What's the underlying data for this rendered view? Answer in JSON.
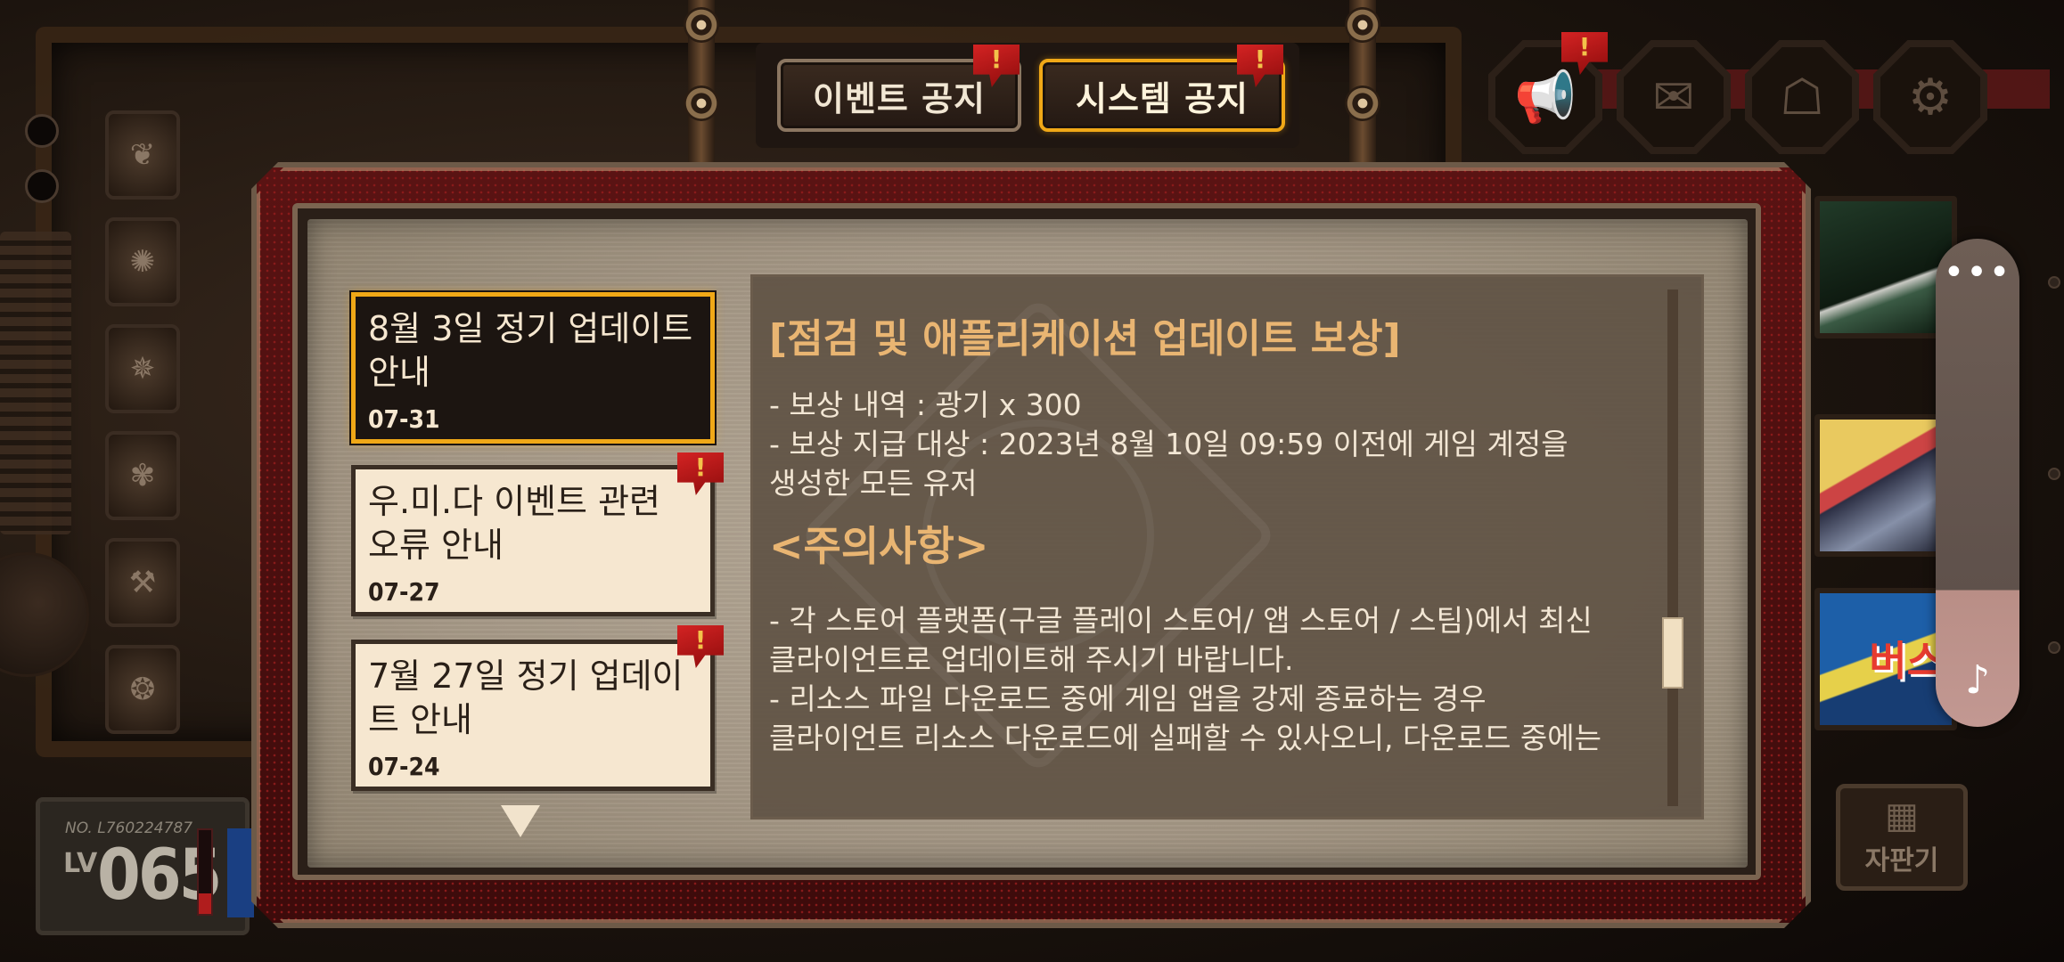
{
  "tabs": [
    {
      "label": "이벤트 공지",
      "active": false,
      "alert": "!"
    },
    {
      "label": "시스템 공지",
      "active": true,
      "alert": "!"
    }
  ],
  "notices": [
    {
      "title": "8월 3일 정기 업데이트 안내",
      "date": "07-31",
      "selected": true,
      "alert": ""
    },
    {
      "title": "우.미.다 이벤트 관련 오류 안내",
      "date": "07-27",
      "selected": false,
      "alert": "!"
    },
    {
      "title": "7월 27일 정기 업데이트 안내",
      "date": "07-24",
      "selected": false,
      "alert": "!"
    }
  ],
  "content": {
    "heading": "[점검 및 애플리케이션 업데이트 보상]",
    "lines1": [
      "- 보상 내역 : 광기 x 300",
      "- 보상 지급 대상 : 2023년 8월 10일 09:59 이전에 게임 계정을",
      "생성한 모든 유저"
    ],
    "subheading": "<주의사항>",
    "lines2": [
      "- 각 스토어 플랫폼(구글 플레이 스토어/ 앱 스토어 / 스팀)에서 최신",
      "클라이언트로 업데이트해 주시기 바랍니다.",
      "- 리소스 파일 다운로드 중에 게임 앱을 강제 종료하는 경우",
      "클라이언트 리소스 다운로드에 실패할 수 있사오니, 다운로드 중에는"
    ]
  },
  "player": {
    "no_label": "NO. L760224787",
    "lv_label": "LV",
    "level": "065",
    "exp_fraction": 0.25
  },
  "vending_label": "자판기",
  "banner_text": "버스",
  "top_alert": "!",
  "widget": {
    "more": "•••",
    "music": "♪"
  },
  "icons": [
    "megaphone-icon",
    "mail-icon",
    "package-icon",
    "gear-icon"
  ]
}
